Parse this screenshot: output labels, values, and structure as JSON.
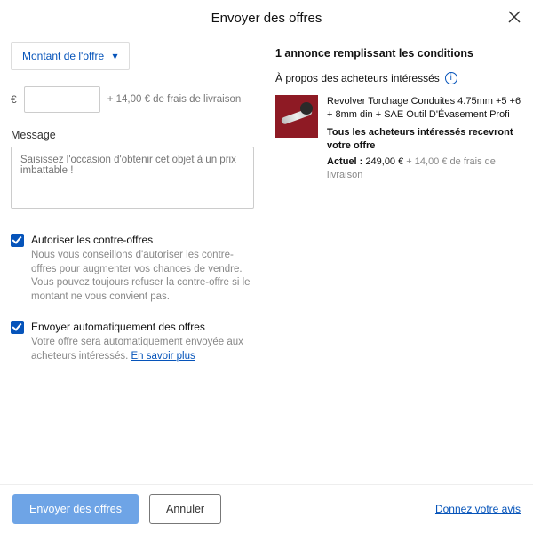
{
  "header": {
    "title": "Envoyer des offres"
  },
  "left": {
    "amount_dropdown_label": "Montant de l'offre",
    "currency_symbol": "€",
    "shipping_suffix": "+ 14,00 € de frais de livraison",
    "message_label": "Message",
    "message_placeholder": "Saisissez l'occasion d'obtenir cet objet à un prix imbattable !",
    "checks": [
      {
        "title": "Autoriser les contre-offres",
        "desc": "Nous vous conseillons d'autoriser les contre-offres pour augmenter vos chances de vendre. Vous pouvez toujours refuser la contre-offre si le montant ne vous convient pas."
      },
      {
        "title": "Envoyer automatiquement des offres",
        "desc": "Votre offre sera automatiquement envoyée aux acheteurs intéressés. ",
        "link": "En savoir plus"
      }
    ]
  },
  "right": {
    "count_heading": "1 annonce remplissant les conditions",
    "about_buyers": "À propos des acheteurs intéressés",
    "listing": {
      "title": "Revolver Torchage Conduites 4.75mm +5 +6 + 8mm din + SAE Outil D'Évasement Profi",
      "notice": "Tous les acheteurs intéressés recevront votre offre",
      "price_label": "Actuel :",
      "price_value": "249,00 €",
      "price_shipping": " + 14,00 € de frais de livraison"
    }
  },
  "footer": {
    "primary": "Envoyer des offres",
    "secondary": "Annuler",
    "feedback": "Donnez votre avis"
  }
}
